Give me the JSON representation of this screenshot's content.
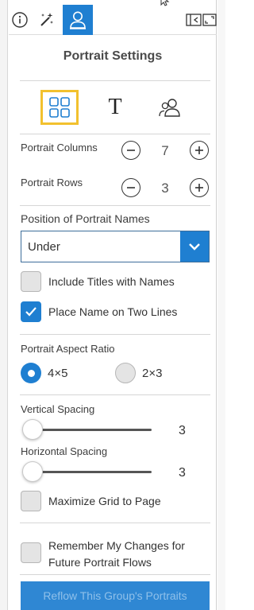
{
  "header": {
    "title": "Portrait Settings"
  },
  "toolbar": {
    "info_icon": "info-circle-icon",
    "wand_icon": "magic-wand-icon",
    "portrait_icon": "portrait-person-icon",
    "collapse_icon": "collapse-panel-icon",
    "expand_icon": "expand-icon"
  },
  "type_tabs": [
    {
      "icon": "grid-layout-icon",
      "selected": true
    },
    {
      "icon": "text-T-icon",
      "glyph": "T",
      "selected": false
    },
    {
      "icon": "people-group-icon",
      "selected": false
    }
  ],
  "columns": {
    "label": "Portrait Columns",
    "value": "7"
  },
  "rows": {
    "label": "Portrait Rows",
    "value": "3"
  },
  "names_position": {
    "label": "Position of Portrait Names",
    "selected": "Under"
  },
  "options": {
    "include_titles": {
      "label": "Include Titles with Names",
      "checked": false
    },
    "two_lines": {
      "label": "Place Name on Two Lines",
      "checked": true
    }
  },
  "aspect": {
    "label": "Portrait Aspect Ratio",
    "choices": [
      {
        "label": "4×5",
        "selected": true
      },
      {
        "label": "2×3",
        "selected": false
      }
    ]
  },
  "vertical_spacing": {
    "label": "Vertical Spacing",
    "value": "3",
    "level": 0
  },
  "horizontal_spacing": {
    "label": "Horizontal Spacing",
    "value": "3",
    "level": 0
  },
  "maximize": {
    "label": "Maximize Grid to Page",
    "checked": false
  },
  "remember": {
    "line1": "Remember My Changes for",
    "line2": "Future Portrait Flows",
    "checked": false
  },
  "reflow_button": {
    "label": "Reflow This Group's Portraits"
  },
  "colors": {
    "accent": "#1f7fd1",
    "highlight": "#f2c12e",
    "button": "#2f87d3"
  }
}
